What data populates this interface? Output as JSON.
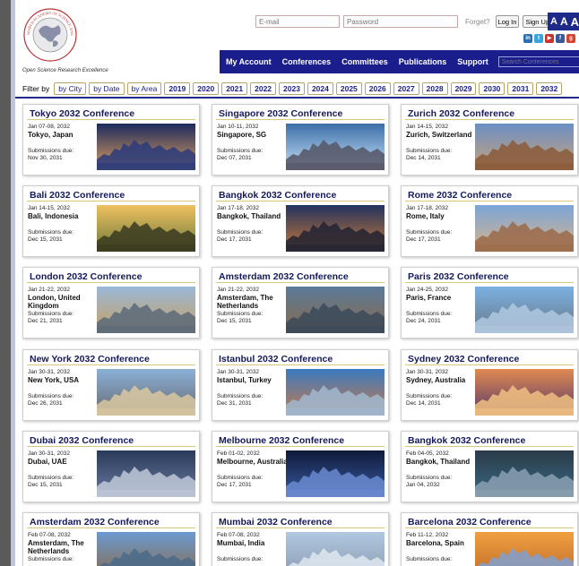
{
  "header": {
    "tagline": "Open Science Research Excellence",
    "logo_text": "WORLD ACADEMY OF SCIENCE, ENGINEERING AND TECHNOLOGY",
    "email_placeholder": "E-mail",
    "password_placeholder": "Password",
    "forgot_label": "Forget?",
    "login_label": "Log In",
    "signup_label": "Sign Up",
    "font_sizes": [
      "A",
      "A",
      "A"
    ],
    "social_icons": [
      "linkedin-icon",
      "twitter-icon",
      "youtube-icon",
      "facebook-icon",
      "googleplus-icon"
    ]
  },
  "nav": {
    "items": [
      "My Account",
      "Conferences",
      "Committees",
      "Publications",
      "Support"
    ],
    "search_placeholder": "Search Conferences"
  },
  "filter": {
    "label": "Filter by",
    "options": [
      "by City",
      "by Date",
      "by Area"
    ],
    "years": [
      "2019",
      "2020",
      "2021",
      "2022",
      "2023",
      "2024",
      "2025",
      "2026",
      "2027",
      "2028",
      "2029",
      "2030",
      "2031",
      "2032"
    ]
  },
  "colors": {
    "nav_bg": "#1a1e8c",
    "title_color": "#14195a",
    "pill_border": "#b8a46a"
  },
  "conferences": [
    {
      "title": "Tokyo 2032 Conference",
      "date": "Jan 07-08, 2032",
      "city": "Tokyo, Japan",
      "due_label": "Submissions due:",
      "due": "Nov 30, 2031"
    },
    {
      "title": "Singapore 2032 Conference",
      "date": "Jan 10-11, 2032",
      "city": "Singapore, SG",
      "due_label": "Submissions due:",
      "due": "Dec 07, 2031"
    },
    {
      "title": "Zurich 2032 Conference",
      "date": "Jan 14-15, 2032",
      "city": "Zurich, Switzerland",
      "due_label": "Submissions due:",
      "due": "Dec 14, 2031"
    },
    {
      "title": "Bali 2032 Conference",
      "date": "Jan 14-15, 2032",
      "city": "Bali, Indonesia",
      "due_label": "Submissions due:",
      "due": "Dec 15, 2031"
    },
    {
      "title": "Bangkok 2032 Conference",
      "date": "Jan 17-18, 2032",
      "city": "Bangkok, Thailand",
      "due_label": "Submissions due:",
      "due": "Dec 17, 2031"
    },
    {
      "title": "Rome 2032 Conference",
      "date": "Jan 17-18, 2032",
      "city": "Rome, Italy",
      "due_label": "Submissions due:",
      "due": "Dec 17, 2031"
    },
    {
      "title": "London 2032 Conference",
      "date": "Jan 21-22, 2032",
      "city": "London, United Kingdom",
      "due_label": "Submissions due:",
      "due": "Dec 21, 2031"
    },
    {
      "title": "Amsterdam 2032 Conference",
      "date": "Jan 21-22, 2032",
      "city": "Amsterdam, The Netherlands",
      "due_label": "Submissions due:",
      "due": "Dec 15, 2031"
    },
    {
      "title": "Paris 2032 Conference",
      "date": "Jan 24-25, 2032",
      "city": "Paris, France",
      "due_label": "Submissions due:",
      "due": "Dec 24, 2031"
    },
    {
      "title": "New York 2032 Conference",
      "date": "Jan 30-31, 2032",
      "city": "New York, USA",
      "due_label": "Submissions due:",
      "due": "Dec 26, 2031"
    },
    {
      "title": "Istanbul 2032 Conference",
      "date": "Jan 30-31, 2032",
      "city": "Istanbul, Turkey",
      "due_label": "Submissions due:",
      "due": "Dec 31, 2031"
    },
    {
      "title": "Sydney 2032 Conference",
      "date": "Jan 30-31, 2032",
      "city": "Sydney, Australia",
      "due_label": "Submissions due:",
      "due": "Dec 14, 2031"
    },
    {
      "title": "Dubai 2032 Conference",
      "date": "Jan 30-31, 2032",
      "city": "Dubai, UAE",
      "due_label": "Submissions due:",
      "due": "Dec 15, 2031"
    },
    {
      "title": "Melbourne 2032 Conference",
      "date": "Feb 01-02, 2032",
      "city": "Melbourne, Australia",
      "due_label": "Submissions due:",
      "due": "Dec 17, 2031"
    },
    {
      "title": "Bangkok 2032 Conference",
      "date": "Feb 04-05, 2032",
      "city": "Bangkok, Thailand",
      "due_label": "Submissions due:",
      "due": "Jan 04, 2032"
    },
    {
      "title": "Amsterdam 2032 Conference",
      "date": "Feb 07-08, 2032",
      "city": "Amsterdam, The Netherlands",
      "due_label": "Submissions due:",
      "due": ""
    },
    {
      "title": "Mumbai 2032 Conference",
      "date": "Feb 07-08, 2032",
      "city": "Mumbai, India",
      "due_label": "Submissions due:",
      "due": ""
    },
    {
      "title": "Barcelona 2032 Conference",
      "date": "Feb 11-12, 2032",
      "city": "Barcelona, Spain",
      "due_label": "Submissions due:",
      "due": ""
    }
  ]
}
